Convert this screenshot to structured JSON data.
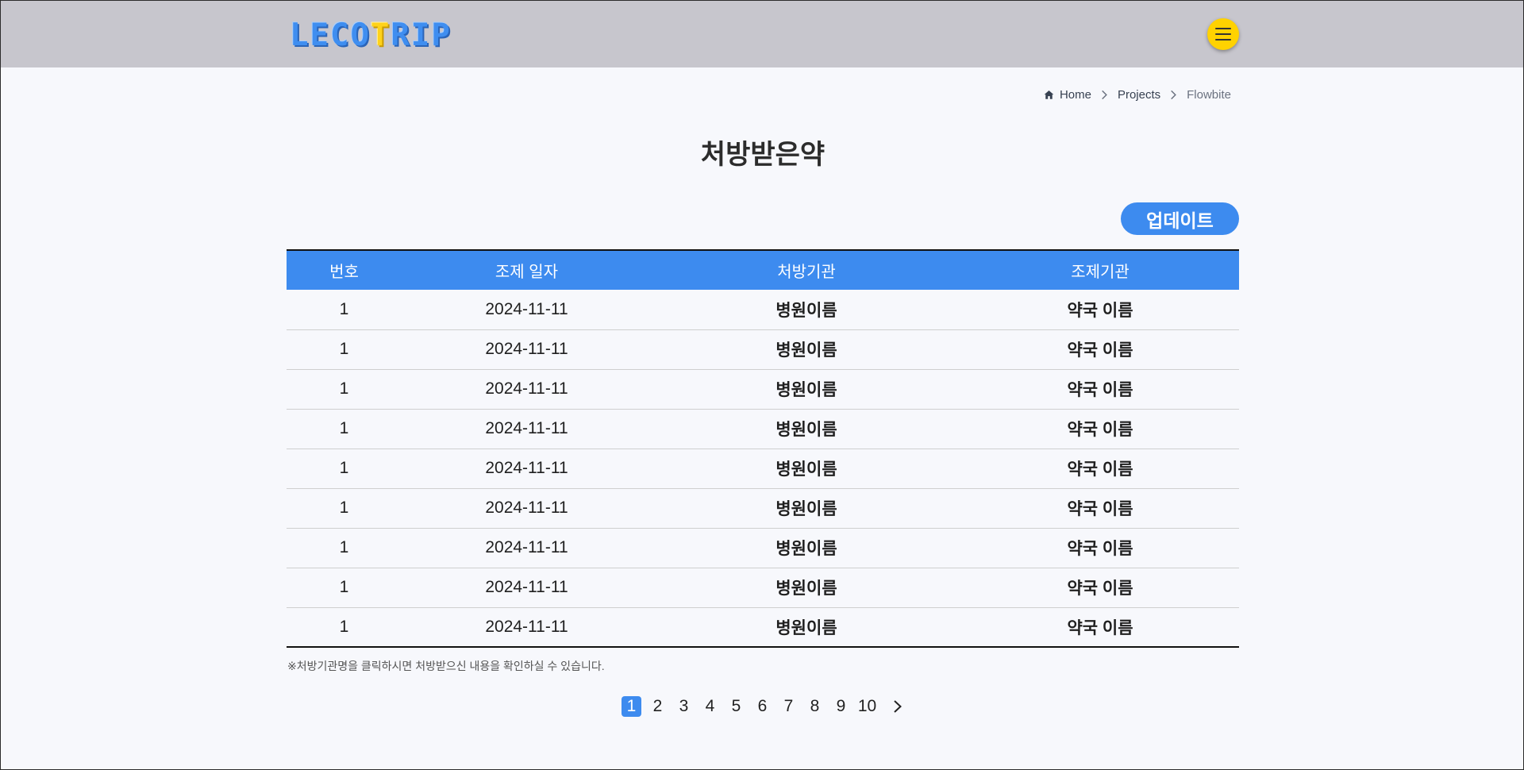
{
  "header": {
    "logo_parts": [
      "LECO",
      "T",
      "RIP"
    ],
    "menu_icon": "hamburger-icon"
  },
  "breadcrumb": {
    "items": [
      {
        "label": "Home",
        "icon": "home-icon"
      },
      {
        "label": "Projects"
      },
      {
        "label": "Flowbite"
      }
    ]
  },
  "page": {
    "title": "처방받은약",
    "update_label": "업데이트"
  },
  "table": {
    "columns": [
      "번호",
      "조제 일자",
      "처방기관",
      "조제기관"
    ],
    "rows": [
      [
        "1",
        "2024-11-11",
        "병원이름",
        "약국 이름"
      ],
      [
        "1",
        "2024-11-11",
        "병원이름",
        "약국 이름"
      ],
      [
        "1",
        "2024-11-11",
        "병원이름",
        "약국 이름"
      ],
      [
        "1",
        "2024-11-11",
        "병원이름",
        "약국 이름"
      ],
      [
        "1",
        "2024-11-11",
        "병원이름",
        "약국 이름"
      ],
      [
        "1",
        "2024-11-11",
        "병원이름",
        "약국 이름"
      ],
      [
        "1",
        "2024-11-11",
        "병원이름",
        "약국 이름"
      ],
      [
        "1",
        "2024-11-11",
        "병원이름",
        "약국 이름"
      ],
      [
        "1",
        "2024-11-11",
        "병원이름",
        "약국 이름"
      ]
    ]
  },
  "note": "※처방기관명을 클릭하시면 처방받으신 내용을 확인하실 수 있습니다.",
  "pagination": {
    "pages": [
      "1",
      "2",
      "3",
      "4",
      "5",
      "6",
      "7",
      "8",
      "9",
      "10"
    ],
    "current": "1",
    "next_icon": "chevron-right-icon"
  },
  "colors": {
    "header_bg": "#c7c6cd",
    "accent": "#3d8bef",
    "menu_button": "#ffd200",
    "page_bg": "#f7f8fc"
  }
}
